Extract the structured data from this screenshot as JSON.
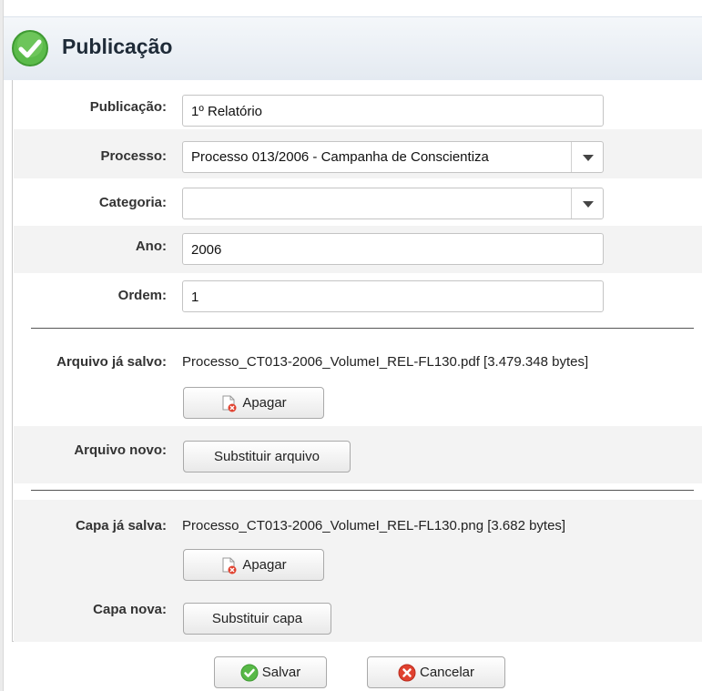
{
  "dialog": {
    "title": "Publicação"
  },
  "form": {
    "publicacao": {
      "label": "Publicação:",
      "value": "1º Relatório"
    },
    "processo": {
      "label": "Processo:",
      "value": "Processo 013/2006 - Campanha de Conscientiza"
    },
    "categoria": {
      "label": "Categoria:",
      "value": ""
    },
    "ano": {
      "label": "Ano:",
      "value": "2006"
    },
    "ordem": {
      "label": "Ordem:",
      "value": "1"
    }
  },
  "arquivo": {
    "saved_label": "Arquivo já salvo:",
    "saved_value": "Processo_CT013-2006_VolumeI_REL-FL130.pdf [3.479.348 bytes]",
    "delete_label": "Apagar",
    "new_label": "Arquivo novo:",
    "replace_label": "Substituir arquivo"
  },
  "capa": {
    "saved_label": "Capa já salva:",
    "saved_value": "Processo_CT013-2006_VolumeI_REL-FL130.png [3.682 bytes]",
    "delete_label": "Apagar",
    "new_label": "Capa nova:",
    "replace_label": "Substituir capa"
  },
  "footer": {
    "save_label": "Salvar",
    "cancel_label": "Cancelar"
  },
  "icons": {
    "title": "check-circle-icon",
    "delete": "file-delete-icon",
    "save": "check-circle-icon",
    "cancel": "close-circle-icon"
  },
  "colors": {
    "check_green": "#58b947",
    "cancel_red": "#e0412f",
    "title_bar": "#e8edf3"
  }
}
